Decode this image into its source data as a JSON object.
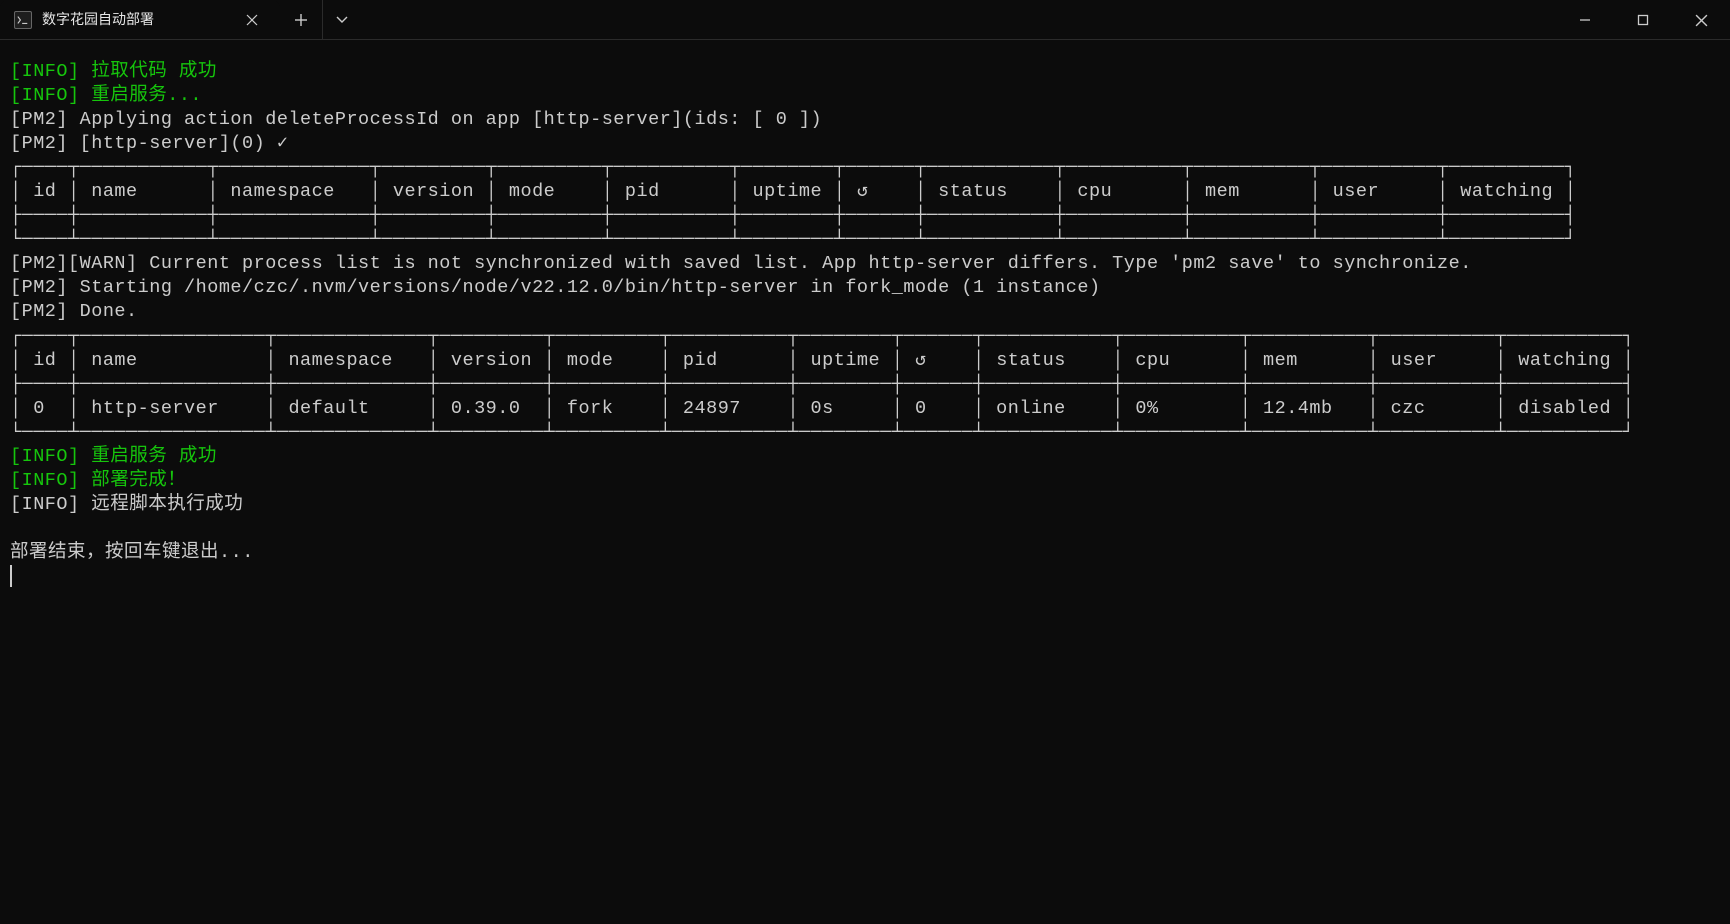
{
  "window": {
    "tab_title": "数字花园自动部署"
  },
  "terminal": {
    "line1_info": "[INFO] 拉取代码 成功",
    "line2_info": "[INFO] 重启服务...",
    "line3": "[PM2] Applying action deleteProcessId on app [http-server](ids: [ 0 ])",
    "line4": "[PM2] [http-server](0) ✓",
    "table1_top": "┌────┬───────────┬─────────────┬─────────┬─────────┬──────────┬────────┬──────┬───────────┬──────────┬──────────┬──────────┬──────────┐",
    "table1_hdr1": "│ id │ name      │ namespace   │ version │ mode    │ pid      │ uptime │ ↺    │ status    │ cpu      │ mem      │ user     │",
    "table1_hdr2": " watching │",
    "table1_sep": "├────┼───────────┼─────────────┼─────────┼─────────┼──────────┼────────┼──────┼───────────┼──────────┼──────────┼──────────┼──────────┤",
    "table1_bot": "└────┴───────────┴─────────────┴─────────┴─────────┴──────────┴────────┴──────┴───────────┴──────────┴──────────┴──────────┴──────────┘",
    "line5": "[PM2][WARN] Current process list is not synchronized with saved list. App http-server differs. Type 'pm2 save' to synchronize.",
    "line6": "[PM2] Starting /home/czc/.nvm/versions/node/v22.12.0/bin/http-server in fork_mode (1 instance)",
    "line7": "[PM2] Done.",
    "table2_top": "┌────┬────────────────┬─────────────┬─────────┬─────────┬──────────┬────────┬──────┬───────────┬──────────┬──────────┬──────────┬──────────┐",
    "table2_hdr1": "│ id │ name           │ namespace   │ version │ mode    │ pid      │ uptime │ ↺    │ status    │ cpu      │ mem      │ user     │ watching │",
    "table2_sep": "├────┼────────────────┼─────────────┼─────────┼─────────┼──────────┼────────┼──────┼───────────┼──────────┼──────────┼──────────┼──────────┤",
    "table2_row": "│ 0  │ http-server    │ default     │ 0.39.0  │ fork    │ 24897    │ 0s     │ 0    │ online    │ 0%       │ 12.4mb   │ czc      │ disabled │",
    "table2_bot": "└────┴────────────────┴─────────────┴─────────┴─────────┴──────────┴────────┴──────┴───────────┴──────────┴──────────┴──────────┴──────────┘",
    "line8_info": "[INFO] 重启服务 成功",
    "line9_info": "[INFO] 部署完成！",
    "line10": "[INFO] 远程脚本执行成功",
    "line11": "部署结束，按回车键退出...",
    "pm2_process": {
      "id": "0",
      "name": "http-server",
      "namespace": "default",
      "version": "0.39.0",
      "mode": "fork",
      "pid": "24897",
      "uptime": "0s",
      "restarts": "0",
      "status": "online",
      "cpu": "0%",
      "mem": "12.4mb",
      "user": "czc",
      "watching": "disabled"
    }
  }
}
